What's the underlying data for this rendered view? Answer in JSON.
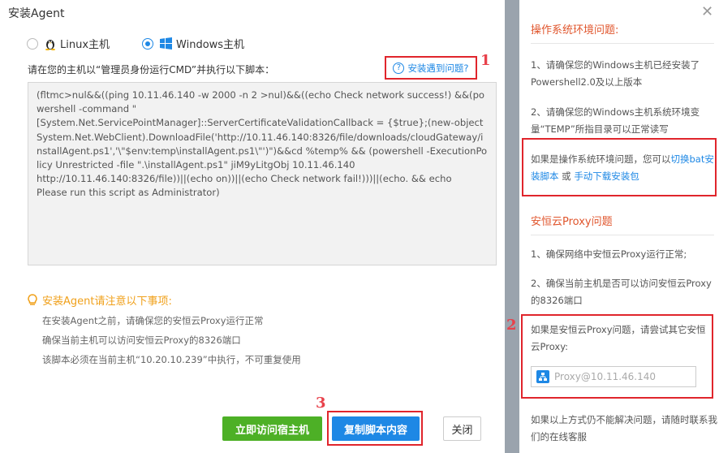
{
  "dialog": {
    "title": "安装Agent",
    "os_options": [
      {
        "label": "Linux主机",
        "selected": false
      },
      {
        "label": "Windows主机",
        "selected": true
      }
    ],
    "instruction": "请在您的主机以“管理员身份运行CMD”并执行以下脚本：",
    "problem_link": "安装遇到问题?",
    "script": "(fltmc>nul&&((ping 10.11.46.140 -w 2000 -n 2 >nul)&&((echo Check network success!) &&(powershell -command \"\n[System.Net.ServicePointManager]::ServerCertificateValidationCallback = {$true};(new-object\nSystem.Net.WebClient).DownloadFile('http://10.11.46.140:8326/file/downloads/cloudGateway/installAgent.ps1','\\\"$env:temp\\installAgent.ps1\\\"')\")&&cd %temp% && (powershell -ExecutionPolicy Unrestricted -file \".\\installAgent.ps1\" jiM9yLitgObj 10.11.46.140\nhttp://10.11.46.140:8326/file))||(echo on))||(echo Check network fail!)))||(echo. && echo\nPlease run this script as Administrator)",
    "notice_title": "安装Agent请注意以下事项:",
    "notices": [
      "在安装Agent之前，请确保您的安恒云Proxy运行正常",
      "确保当前主机可以访问安恒云Proxy的8326端口",
      "该脚本必须在当前主机“10.20.10.239”中执行，不可重复使用"
    ],
    "buttons": {
      "visit_host": "立即访问宿主机",
      "copy_script": "复制脚本内容",
      "close": "关闭"
    }
  },
  "annotations": {
    "n1": "1",
    "n2": "2",
    "n3": "3"
  },
  "panel": {
    "os_section": {
      "title": "操作系统环境问题:",
      "item1": "1、请确保您的Windows主机已经安装了Powershell2.0及以上版本",
      "item2": "2、请确保您的Windows主机系统环境变量“TEMP”所指目录可以正常读写",
      "tip_prefix": "如果是操作系统环境问题，您可以",
      "tip_link1": "切换bat安装脚本",
      "tip_or": " 或 ",
      "tip_link2": "手动下载安装包"
    },
    "proxy_section": {
      "title": "安恒云Proxy问题",
      "item1": "1、确保网络中安恒云Proxy运行正常;",
      "item2": "2、确保当前主机是否可以访问安恒云Proxy的8326端口",
      "tip": "如果是安恒云Proxy问题，请尝试其它安恒云Proxy:",
      "proxy_placeholder": "Proxy@10.11.46.140"
    },
    "footer": "如果以上方式仍不能解决问题，请随时联系我们的在线客服"
  },
  "colors": {
    "accent_blue": "#1e88e5",
    "green": "#4db026",
    "annotation_red": "#e0252c",
    "notice_orange": "#f0a01a",
    "section_title": "#e0552c"
  }
}
